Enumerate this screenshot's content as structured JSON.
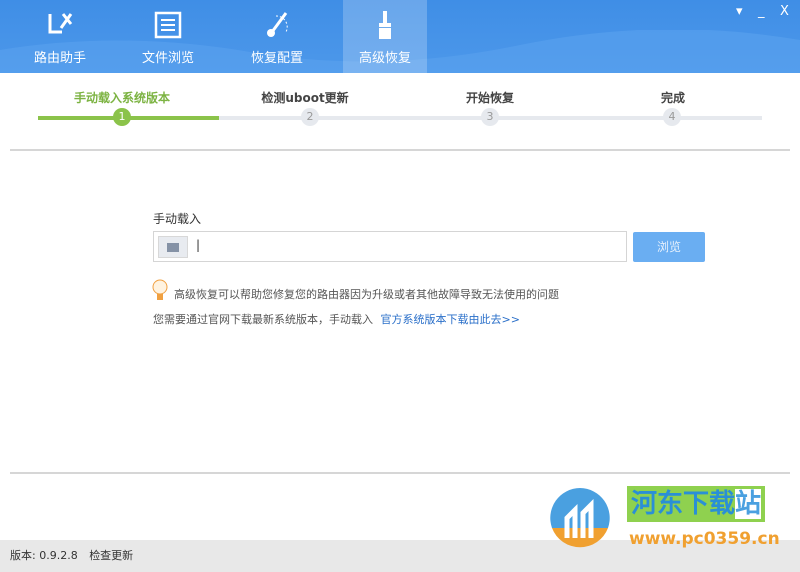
{
  "tabs": [
    {
      "label": "路由助手"
    },
    {
      "label": "文件浏览"
    },
    {
      "label": "恢复配置"
    },
    {
      "label": "高级恢复"
    }
  ],
  "window": {
    "menu": "▾",
    "minimize": "_",
    "close": "X"
  },
  "steps": [
    {
      "label": "手动载入系统版本",
      "num": "1"
    },
    {
      "label": "检测uboot更新",
      "num": "2"
    },
    {
      "label": "开始恢复",
      "num": "3"
    },
    {
      "label": "完成",
      "num": "4"
    }
  ],
  "form": {
    "title": "手动载入",
    "value": "|",
    "browse": "浏览"
  },
  "tip": "高级恢复可以帮助您修复您的路由器因为升级或者其他故障导致无法使用的问题",
  "note": "您需要通过官网下载最新系统版本，手动载入",
  "link": "官方系统版本下载由此去>>",
  "footer": {
    "version": "版本: 0.9.2.8",
    "check": "检查更新"
  },
  "watermark": {
    "name": "河东下载站",
    "url": "www.pc0359.cn"
  },
  "colors": {
    "header": "#4690e8",
    "active_step": "#8bc34a",
    "link": "#2a6fc9"
  }
}
